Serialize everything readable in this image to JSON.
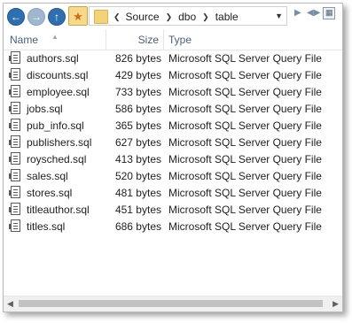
{
  "toolbar": {
    "back_icon": "arrow-left-icon",
    "forward_icon": "arrow-right-icon",
    "up_icon": "arrow-up-icon",
    "favorites_icon": "star-folder-icon",
    "address": {
      "crumbs": [
        "Source",
        "dbo",
        "table"
      ]
    }
  },
  "columns": {
    "name": "Name",
    "size": "Size",
    "type": "Type"
  },
  "files": [
    {
      "name": "authors.sql",
      "size": "826 bytes",
      "type": "Microsoft SQL Server Query File"
    },
    {
      "name": "discounts.sql",
      "size": "429 bytes",
      "type": "Microsoft SQL Server Query File"
    },
    {
      "name": "employee.sql",
      "size": "733 bytes",
      "type": "Microsoft SQL Server Query File"
    },
    {
      "name": "jobs.sql",
      "size": "586 bytes",
      "type": "Microsoft SQL Server Query File"
    },
    {
      "name": "pub_info.sql",
      "size": "365 bytes",
      "type": "Microsoft SQL Server Query File"
    },
    {
      "name": "publishers.sql",
      "size": "627 bytes",
      "type": "Microsoft SQL Server Query File"
    },
    {
      "name": "roysched.sql",
      "size": "413 bytes",
      "type": "Microsoft SQL Server Query File"
    },
    {
      "name": "sales.sql",
      "size": "520 bytes",
      "type": "Microsoft SQL Server Query File"
    },
    {
      "name": "stores.sql",
      "size": "481 bytes",
      "type": "Microsoft SQL Server Query File"
    },
    {
      "name": "titleauthor.sql",
      "size": "451 bytes",
      "type": "Microsoft SQL Server Query File"
    },
    {
      "name": "titles.sql",
      "size": "686 bytes",
      "type": "Microsoft SQL Server Query File"
    }
  ]
}
